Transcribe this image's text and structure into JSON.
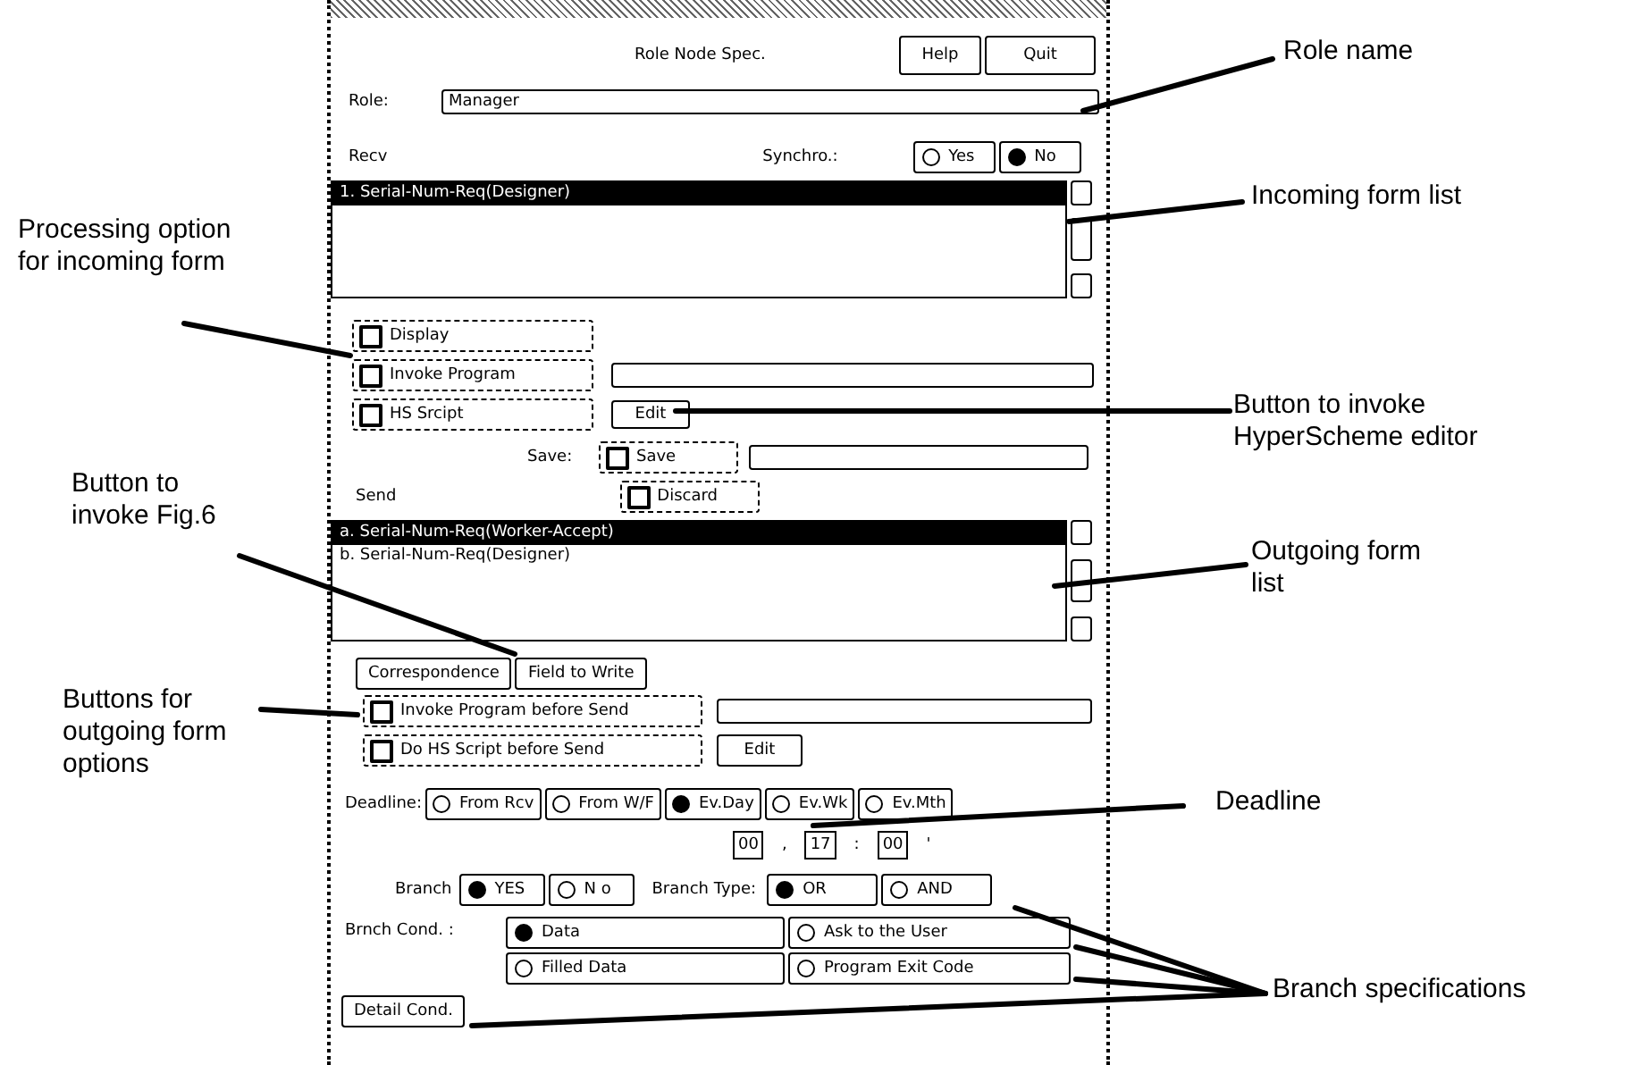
{
  "dialog": {
    "title": "Role Node Spec.",
    "help_button": "Help",
    "quit_button": "Quit",
    "role": {
      "label": "Role:",
      "value": "Manager"
    },
    "recv_label": "Recv",
    "synchro": {
      "label": "Synchro.:",
      "options": [
        {
          "label": "Yes",
          "selected": false
        },
        {
          "label": "No",
          "selected": true
        }
      ]
    },
    "recv_list": [
      {
        "text": "1. Serial-Num-Req(Designer)",
        "selected": true
      }
    ],
    "processing_options": [
      {
        "label": "Display"
      },
      {
        "label": "Invoke Program"
      },
      {
        "label": "HS Srcipt"
      }
    ],
    "edit_button": "Edit",
    "save": {
      "label": "Save:",
      "options": [
        {
          "label": "Save"
        },
        {
          "label": "Discard"
        }
      ]
    },
    "send_label": "Send",
    "send_list": [
      {
        "text": "a. Serial-Num-Req(Worker-Accept)",
        "selected": true
      },
      {
        "text": "b. Serial-Num-Req(Designer)",
        "selected": false
      }
    ],
    "correspondence_button": "Correspondence",
    "fields_button": "Field to Write",
    "send_options": [
      {
        "label": "Invoke Program before Send"
      },
      {
        "label": "Do HS Script before Send"
      }
    ],
    "send_edit_button": "Edit",
    "deadline": {
      "label": "Deadline:",
      "options": [
        {
          "label": "From Rcv",
          "selected": false
        },
        {
          "label": "From W/F",
          "selected": false
        },
        {
          "label": "Ev.Day",
          "selected": true
        },
        {
          "label": "Ev.Wk",
          "selected": false
        },
        {
          "label": "Ev.Mth",
          "selected": false
        }
      ],
      "time": [
        {
          "value": "00",
          "separator": ","
        },
        {
          "value": "17",
          "separator": ":"
        },
        {
          "value": "00",
          "separator": "'"
        }
      ]
    },
    "branch": {
      "label": "Branch",
      "options": [
        {
          "label": "YES",
          "selected": true
        },
        {
          "label": "N o",
          "selected": false
        }
      ]
    },
    "branch_type": {
      "label": "Branch Type:",
      "options": [
        {
          "label": "OR",
          "selected": true
        },
        {
          "label": "AND",
          "selected": false
        }
      ]
    },
    "branch_cond": {
      "label": "Brnch Cond. :",
      "options": [
        {
          "label": "Data",
          "selected": true
        },
        {
          "label": "Ask to the User",
          "selected": false
        },
        {
          "label": "Filled Data",
          "selected": false
        },
        {
          "label": "Program Exit Code",
          "selected": false
        }
      ]
    },
    "detail_button": "Detail Cond."
  },
  "annotations": [
    {
      "text": "Role name"
    },
    {
      "text": "Incoming form list"
    },
    {
      "text": "Processing option\nfor incoming form"
    },
    {
      "text": "Button to invoke\nHyperScheme editor"
    },
    {
      "text": "Outgoing form\nlist"
    },
    {
      "text": "Button to\ninvoke Fig.6"
    },
    {
      "text": "Buttons for\noutgoing form\noptions"
    },
    {
      "text": "Deadline"
    },
    {
      "text": "Branch specifications"
    }
  ]
}
